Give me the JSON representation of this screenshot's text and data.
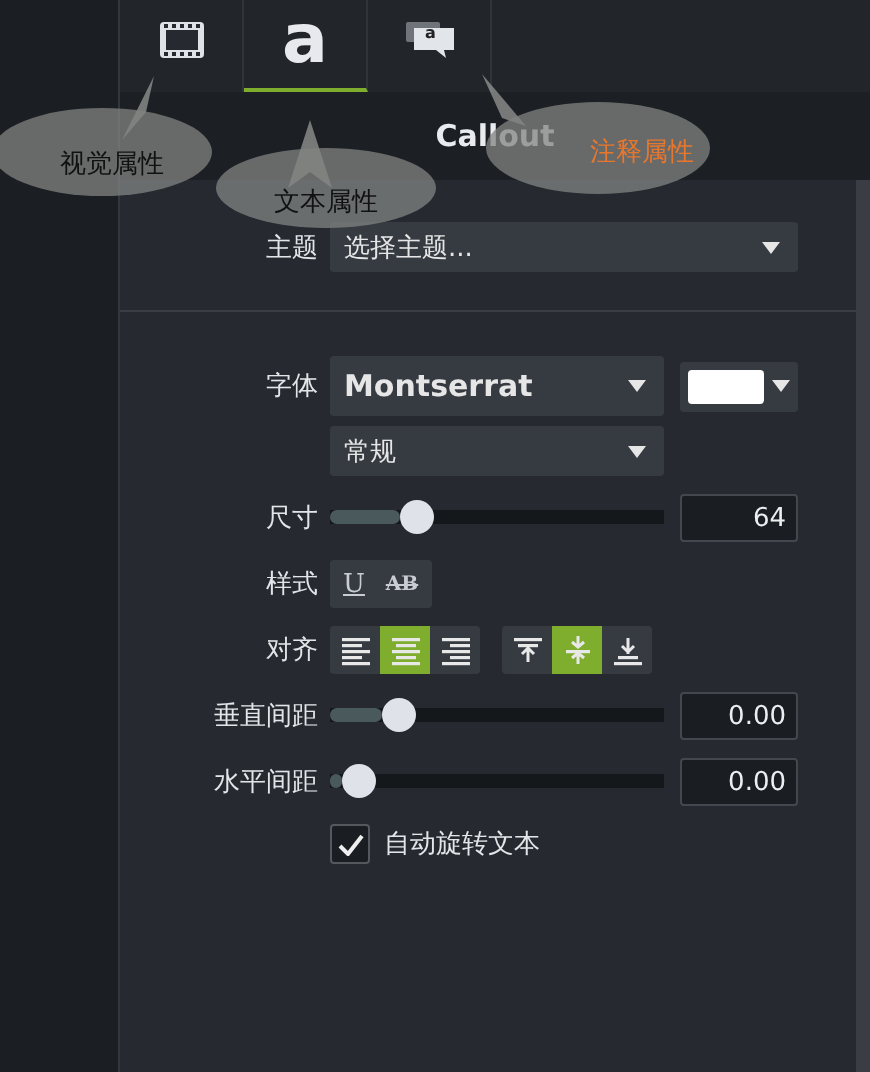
{
  "tabs": [
    {
      "kind": "film",
      "selected": false
    },
    {
      "kind": "text",
      "label": "a",
      "selected": true
    },
    {
      "kind": "callout",
      "label": "a",
      "selected": false
    }
  ],
  "title": "Callout",
  "theme": {
    "label": "主题",
    "value": "选择主题..."
  },
  "font": {
    "label": "字体",
    "family": "Montserrat",
    "weight": "常规",
    "color": "#ffffff"
  },
  "size": {
    "label": "尺寸",
    "level": 0.23,
    "reading": "64"
  },
  "style": {
    "label": "样式",
    "buttons": [
      {
        "kind": "underline",
        "label": "U"
      },
      {
        "kind": "strike",
        "label": "AB"
      }
    ]
  },
  "align": {
    "label": "对齐",
    "groups": [
      [
        {
          "kind": "left",
          "selected": false
        },
        {
          "kind": "center",
          "selected": true
        },
        {
          "kind": "right",
          "selected": false
        }
      ],
      [
        {
          "kind": "top",
          "selected": false
        },
        {
          "kind": "middle",
          "selected": true
        },
        {
          "kind": "bottom",
          "selected": false
        }
      ]
    ]
  },
  "spacing": [
    {
      "label": "垂直间距",
      "level": 0.17,
      "reading": "0.00"
    },
    {
      "label": "水平间距",
      "level": 0.04,
      "reading": "0.00"
    }
  ],
  "auto_rotate": {
    "label": "自动旋转文本",
    "checked": true
  },
  "annotations": [
    {
      "text": "视觉属性",
      "color": "#111111"
    },
    {
      "text": "文本属性",
      "color": "#111111"
    },
    {
      "text": "注释属性",
      "color": "#e8772e"
    }
  ]
}
